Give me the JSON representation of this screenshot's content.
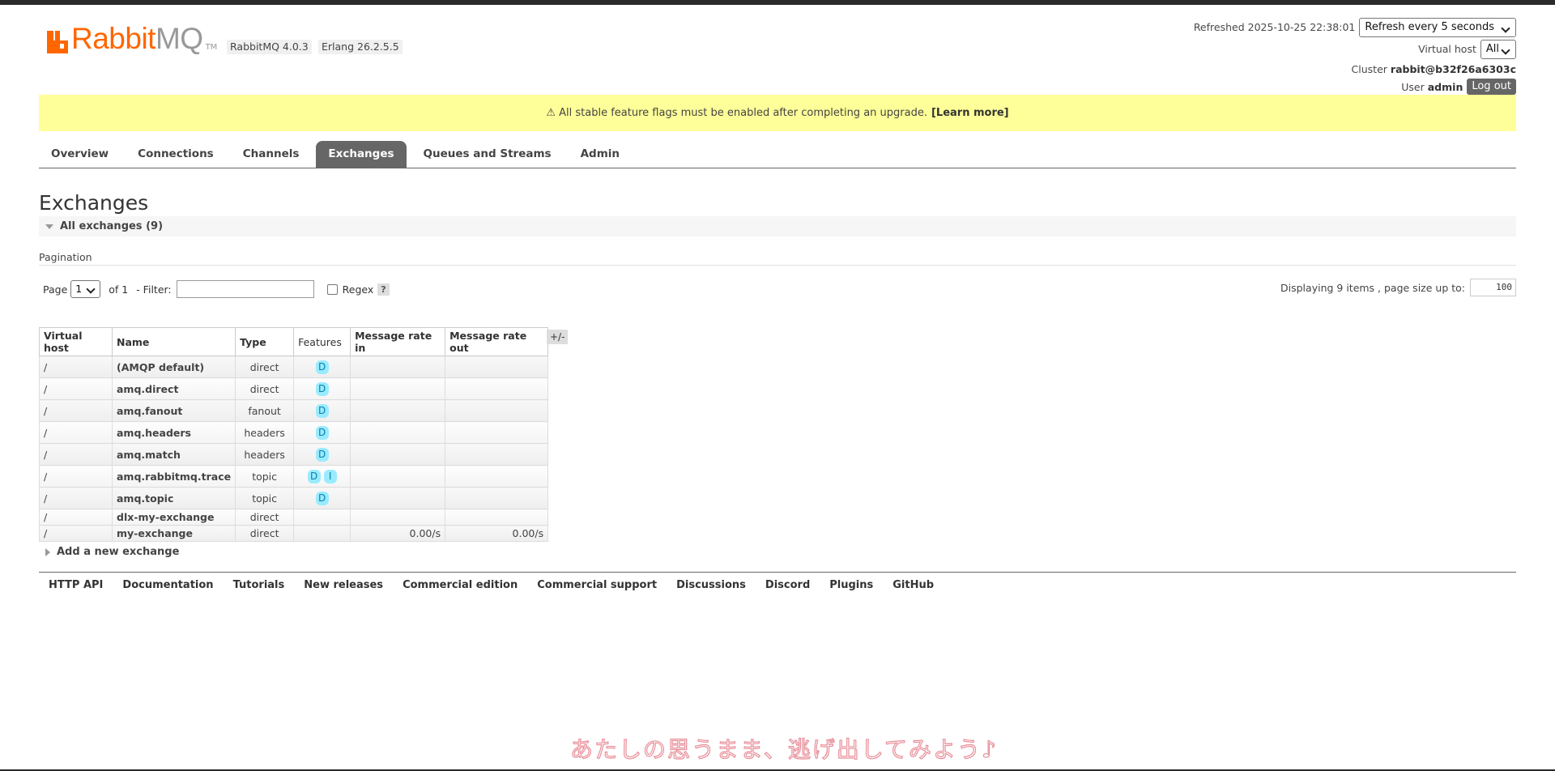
{
  "app": {
    "logo_rabbit": "Rabbit",
    "logo_mq": "MQ",
    "logo_tm": "TM",
    "version": "RabbitMQ 4.0.3",
    "erlang": "Erlang 26.2.5.5",
    "brand_color": "#ff6600"
  },
  "header": {
    "refreshed_label": "Refreshed 2025-10-25 22:38:01",
    "refresh_select": "Refresh every 5 seconds",
    "vhost_label": "Virtual host",
    "vhost_value": "All",
    "cluster_label": "Cluster",
    "cluster_value": "rabbit@b32f26a6303c",
    "user_label": "User",
    "user_value": "admin",
    "logout": "Log out"
  },
  "banner": {
    "text": "⚠ All stable feature flags must be enabled after completing an upgrade.",
    "link": "[Learn more]"
  },
  "tabs": [
    {
      "label": "Overview",
      "active": false
    },
    {
      "label": "Connections",
      "active": false
    },
    {
      "label": "Channels",
      "active": false
    },
    {
      "label": "Exchanges",
      "active": true
    },
    {
      "label": "Queues and Streams",
      "active": false
    },
    {
      "label": "Admin",
      "active": false
    }
  ],
  "page": {
    "title": "Exchanges",
    "section_title": "All exchanges (9)",
    "pagination_label": "Pagination",
    "page_label": "Page",
    "page_value": "1",
    "of_label": "of 1",
    "filter_label": "- Filter:",
    "regex_label": "Regex",
    "help": "?",
    "displaying": "Displaying 9 items , page size up to:",
    "page_size": "100",
    "columns_toggle": "+/-",
    "add_new": "Add a new exchange"
  },
  "table": {
    "headers": [
      "Virtual host",
      "Name",
      "Type",
      "Features",
      "Message rate in",
      "Message rate out"
    ],
    "rows": [
      {
        "vhost": "/",
        "name": "(AMQP default)",
        "type": "direct",
        "features": [
          "D"
        ],
        "rate_in": "",
        "rate_out": ""
      },
      {
        "vhost": "/",
        "name": "amq.direct",
        "type": "direct",
        "features": [
          "D"
        ],
        "rate_in": "",
        "rate_out": ""
      },
      {
        "vhost": "/",
        "name": "amq.fanout",
        "type": "fanout",
        "features": [
          "D"
        ],
        "rate_in": "",
        "rate_out": ""
      },
      {
        "vhost": "/",
        "name": "amq.headers",
        "type": "headers",
        "features": [
          "D"
        ],
        "rate_in": "",
        "rate_out": ""
      },
      {
        "vhost": "/",
        "name": "amq.match",
        "type": "headers",
        "features": [
          "D"
        ],
        "rate_in": "",
        "rate_out": ""
      },
      {
        "vhost": "/",
        "name": "amq.rabbitmq.trace",
        "type": "topic",
        "features": [
          "D",
          "I"
        ],
        "rate_in": "",
        "rate_out": ""
      },
      {
        "vhost": "/",
        "name": "amq.topic",
        "type": "topic",
        "features": [
          "D"
        ],
        "rate_in": "",
        "rate_out": ""
      },
      {
        "vhost": "/",
        "name": "dlx-my-exchange",
        "type": "direct",
        "features": [],
        "rate_in": "",
        "rate_out": ""
      },
      {
        "vhost": "/",
        "name": "my-exchange",
        "type": "direct",
        "features": [],
        "rate_in": "0.00/s",
        "rate_out": "0.00/s"
      }
    ]
  },
  "footer": [
    "HTTP API",
    "Documentation",
    "Tutorials",
    "New releases",
    "Commercial edition",
    "Commercial support",
    "Discussions",
    "Discord",
    "Plugins",
    "GitHub"
  ],
  "caption": "あたしの思うまま、逃げ出してみよう♪"
}
